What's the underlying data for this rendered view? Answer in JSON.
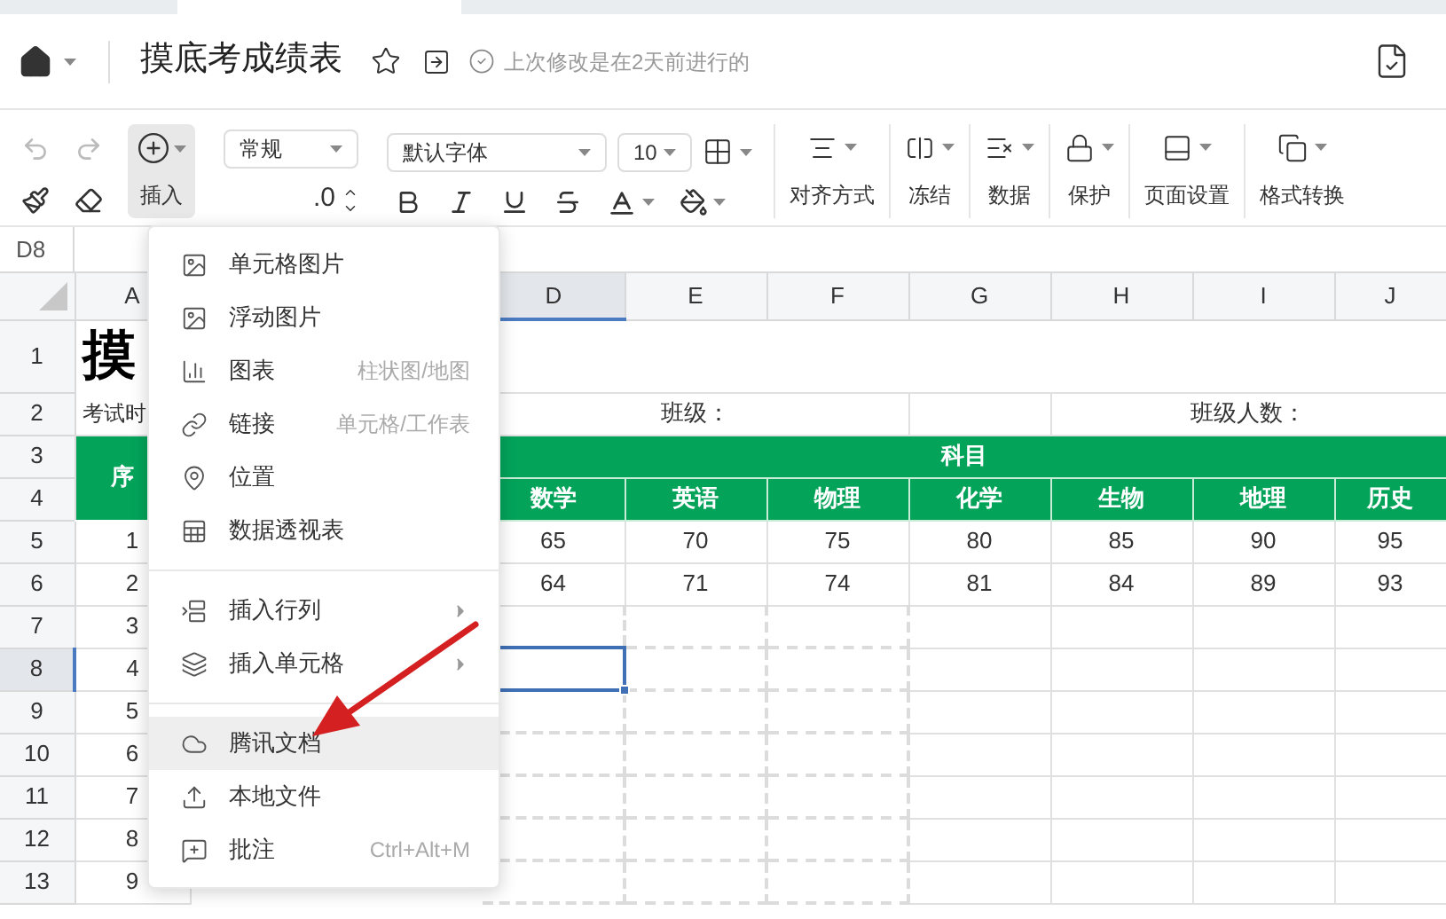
{
  "header": {
    "title": "摸底考成绩表",
    "status": "上次修改是在2天前进行的"
  },
  "toolbar": {
    "undo": {
      "disabled": true
    },
    "redo": {
      "disabled": true
    },
    "insert": {
      "label": "插入",
      "active": true
    },
    "number_format": "常规",
    "decimal": ".0",
    "font": "默认字体",
    "font_size": "10",
    "groups": [
      {
        "label": "对齐方式"
      },
      {
        "label": "冻结"
      },
      {
        "label": "数据"
      },
      {
        "label": "保护"
      },
      {
        "label": "页面设置"
      },
      {
        "label": "格式转换"
      }
    ]
  },
  "name_box": "D8",
  "columns": [
    {
      "label": "A",
      "selected": false
    },
    {
      "label": "D",
      "selected": true
    },
    {
      "label": "E",
      "selected": false
    },
    {
      "label": "F",
      "selected": false
    },
    {
      "label": "G",
      "selected": false
    },
    {
      "label": "H",
      "selected": false
    },
    {
      "label": "I",
      "selected": false
    },
    {
      "label": "J",
      "selected": false
    }
  ],
  "rows": [
    {
      "kind": "title",
      "number": "1",
      "selected": false,
      "a": "摸"
    },
    {
      "kind": "info",
      "number": "2",
      "selected": false,
      "a": "考试时",
      "class_label": "班级：",
      "size_label": "班级人数："
    },
    {
      "kind": "group",
      "number": "3",
      "selected": false,
      "a": "序",
      "text": "科目"
    },
    {
      "kind": "subjects",
      "number": "4",
      "selected": false,
      "cells": [
        "数学",
        "英语",
        "物理",
        "化学",
        "生物",
        "地理",
        "历史"
      ]
    },
    {
      "kind": "data",
      "number": "5",
      "selected": false,
      "marked": false,
      "a": "1",
      "cells": [
        "65",
        "70",
        "75",
        "80",
        "85",
        "90",
        "95"
      ]
    },
    {
      "kind": "data",
      "number": "6",
      "selected": false,
      "marked": false,
      "a": "2",
      "cells": [
        "64",
        "71",
        "74",
        "81",
        "84",
        "89",
        "93"
      ]
    },
    {
      "kind": "data",
      "number": "7",
      "selected": false,
      "marked": true,
      "a": "3",
      "cells": []
    },
    {
      "kind": "data",
      "number": "8",
      "selected": true,
      "marked": true,
      "a": "4",
      "cells": []
    },
    {
      "kind": "data",
      "number": "9",
      "selected": false,
      "marked": true,
      "a": "5",
      "cells": []
    },
    {
      "kind": "data",
      "number": "10",
      "selected": false,
      "marked": true,
      "a": "6",
      "cells": []
    },
    {
      "kind": "data",
      "number": "11",
      "selected": false,
      "marked": true,
      "a": "7",
      "cells": []
    },
    {
      "kind": "data",
      "number": "12",
      "selected": false,
      "marked": true,
      "a": "8",
      "cells": []
    },
    {
      "kind": "data",
      "number": "13",
      "selected": false,
      "marked": true,
      "a": "9",
      "cells": []
    }
  ],
  "menu": {
    "sections": [
      [
        {
          "label": "单元格图片",
          "submenu": false,
          "highlighted": false
        },
        {
          "label": "浮动图片",
          "submenu": false,
          "highlighted": false
        },
        {
          "label": "图表",
          "hint": "柱状图/地图",
          "submenu": false,
          "highlighted": false
        },
        {
          "label": "链接",
          "hint": "单元格/工作表",
          "submenu": false,
          "highlighted": false
        },
        {
          "label": "位置",
          "submenu": false,
          "highlighted": false
        },
        {
          "label": "数据透视表",
          "submenu": false,
          "highlighted": false
        }
      ],
      [
        {
          "label": "插入行列",
          "submenu": true,
          "highlighted": false
        },
        {
          "label": "插入单元格",
          "submenu": true,
          "highlighted": false
        }
      ],
      [
        {
          "label": "腾讯文档",
          "submenu": false,
          "highlighted": true
        },
        {
          "label": "本地文件",
          "submenu": false,
          "highlighted": false
        },
        {
          "label": "批注",
          "hint": "Ctrl+Alt+M",
          "submenu": false,
          "highlighted": false
        }
      ]
    ]
  }
}
